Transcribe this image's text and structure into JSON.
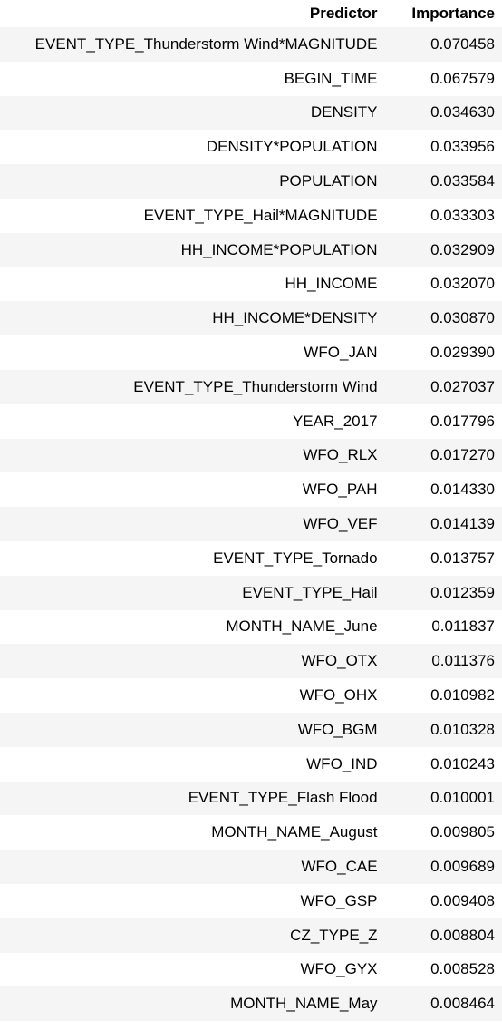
{
  "table": {
    "headers": [
      "Predictor",
      "Importance"
    ],
    "rows": [
      [
        "EVENT_TYPE_Thunderstorm Wind*MAGNITUDE",
        "0.070458"
      ],
      [
        "BEGIN_TIME",
        "0.067579"
      ],
      [
        "DENSITY",
        "0.034630"
      ],
      [
        "DENSITY*POPULATION",
        "0.033956"
      ],
      [
        "POPULATION",
        "0.033584"
      ],
      [
        "EVENT_TYPE_Hail*MAGNITUDE",
        "0.033303"
      ],
      [
        "HH_INCOME*POPULATION",
        "0.032909"
      ],
      [
        "HH_INCOME",
        "0.032070"
      ],
      [
        "HH_INCOME*DENSITY",
        "0.030870"
      ],
      [
        "WFO_JAN",
        "0.029390"
      ],
      [
        "EVENT_TYPE_Thunderstorm Wind",
        "0.027037"
      ],
      [
        "YEAR_2017",
        "0.017796"
      ],
      [
        "WFO_RLX",
        "0.017270"
      ],
      [
        "WFO_PAH",
        "0.014330"
      ],
      [
        "WFO_VEF",
        "0.014139"
      ],
      [
        "EVENT_TYPE_Tornado",
        "0.013757"
      ],
      [
        "EVENT_TYPE_Hail",
        "0.012359"
      ],
      [
        "MONTH_NAME_June",
        "0.011837"
      ],
      [
        "WFO_OTX",
        "0.011376"
      ],
      [
        "WFO_OHX",
        "0.010982"
      ],
      [
        "WFO_BGM",
        "0.010328"
      ],
      [
        "WFO_IND",
        "0.010243"
      ],
      [
        "EVENT_TYPE_Flash Flood",
        "0.010001"
      ],
      [
        "MONTH_NAME_August",
        "0.009805"
      ],
      [
        "WFO_CAE",
        "0.009689"
      ],
      [
        "WFO_GSP",
        "0.009408"
      ],
      [
        "CZ_TYPE_Z",
        "0.008804"
      ],
      [
        "WFO_GYX",
        "0.008528"
      ],
      [
        "MONTH_NAME_May",
        "0.008464"
      ]
    ]
  }
}
